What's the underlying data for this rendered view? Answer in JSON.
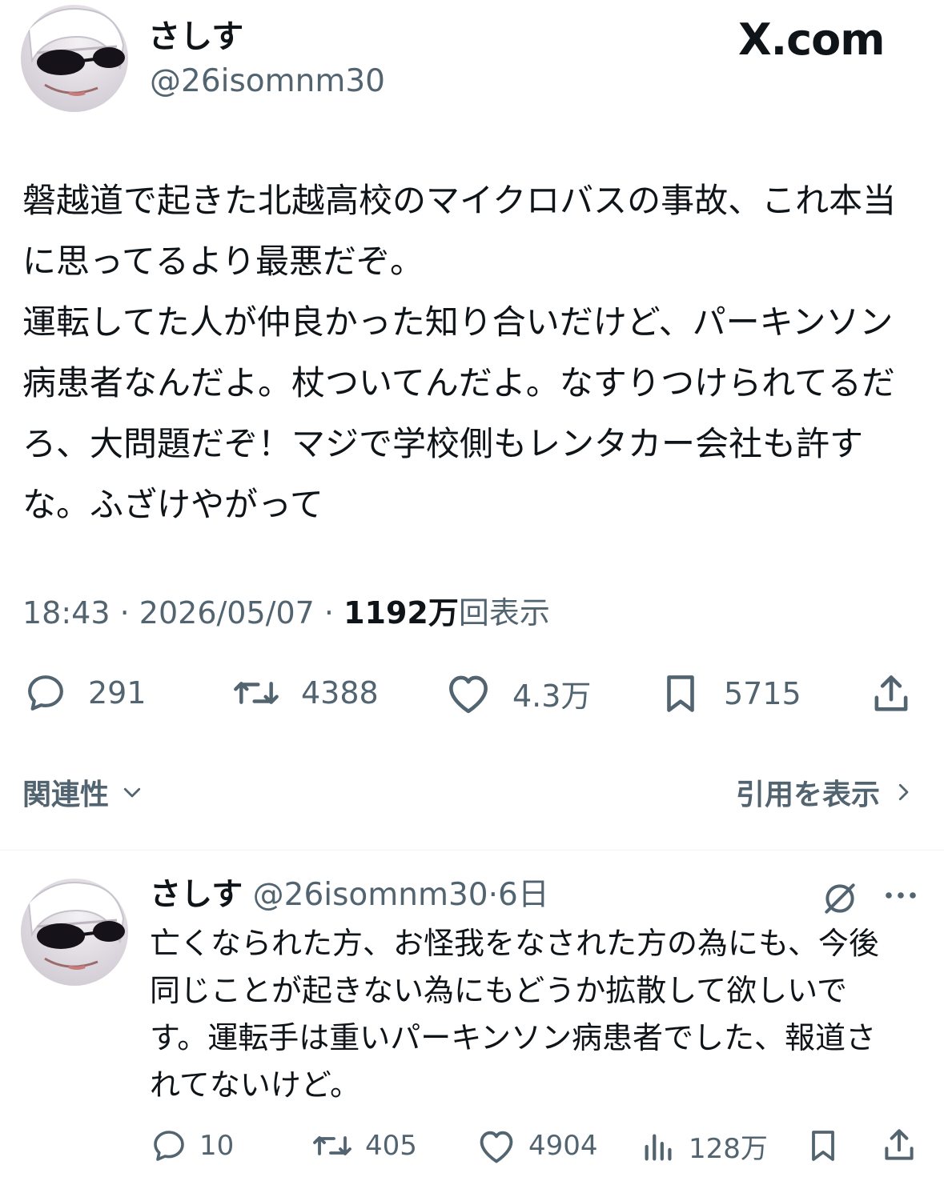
{
  "tweet": {
    "author_name": "さしす",
    "author_handle": "@26isomnm30",
    "watermark": "X.com",
    "text": "磐越道で起きた北越高校のマイクロバスの事故、これ本当に思ってるより最悪だぞ。\n運転してた人が仲良かった知り合いだけど、パーキンソン病患者なんだよ。杖ついてんだよ。なすりつけられてるだろ、大問題だぞ！マジで学校側もレンタカー会社も許すな。ふざけやがって",
    "time": "18:43",
    "date": "2026/05/07",
    "separator": "·",
    "views_count": "1192万",
    "views_label": "回表示",
    "actions": {
      "replies": "291",
      "retweets": "4388",
      "likes": "4.3万",
      "bookmarks": "5715"
    },
    "icons": [
      "reply-icon",
      "retweet-icon",
      "like-icon",
      "bookmark-icon",
      "share-icon"
    ]
  },
  "sections": {
    "related_label": "関連性",
    "quotes_label": "引用を表示"
  },
  "reply": {
    "author_name": "さしす",
    "author_handle": "@26isomnm30",
    "time_ago": "6日",
    "text": "亡くなられた方、お怪我をなされた方の為にも、今後同じことが起きない為にもどうか拡散して欲しいです。運転手は重いパーキンソン病患者でした、報道されてないけど。",
    "actions": {
      "replies": "10",
      "retweets": "405",
      "likes": "4904",
      "views": "128万"
    }
  },
  "colors": {
    "text": "#0f1419",
    "secondary": "#536471",
    "divider": "#eff3f4",
    "background": "#ffffff"
  }
}
